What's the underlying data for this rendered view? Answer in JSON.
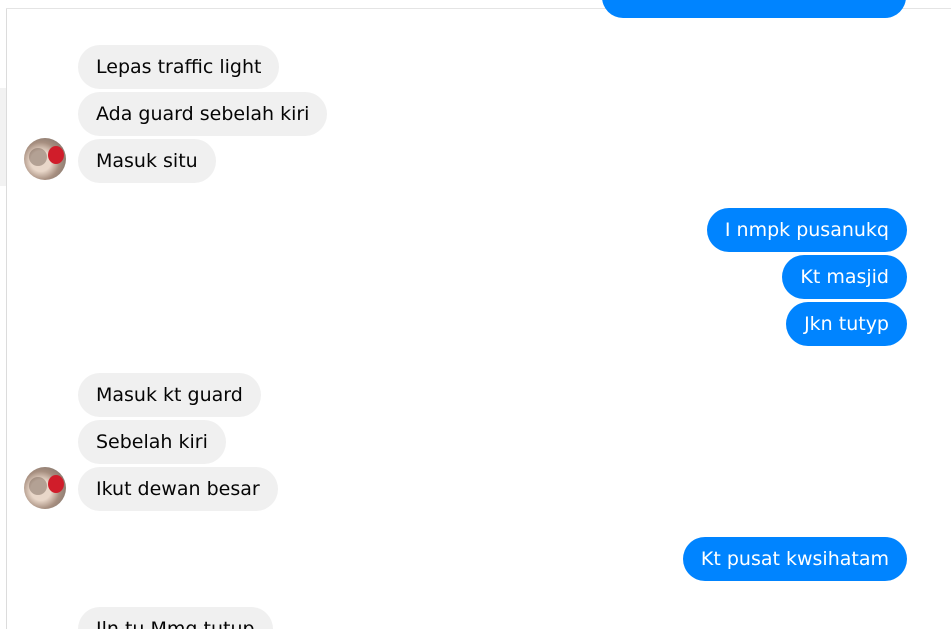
{
  "conversation": {
    "groups": [
      {
        "sender": "them",
        "avatar_icon": "user-avatar-icon",
        "messages": [
          "Lepas traffic light",
          "Ada guard sebelah kiri",
          "Masuk situ"
        ]
      },
      {
        "sender": "me",
        "messages": [
          "I nmpk pusanukq",
          "Kt masjid",
          "Jkn tutyp"
        ]
      },
      {
        "sender": "them",
        "avatar_icon": "user-avatar-icon",
        "messages": [
          "Masuk kt guard",
          "Sebelah kiri",
          "Ikut dewan besar"
        ]
      },
      {
        "sender": "me",
        "messages": [
          "Kt pusat kwsihatam"
        ]
      },
      {
        "sender": "them",
        "messages": [
          "Jln tu Mmg tutup"
        ]
      }
    ]
  },
  "colors": {
    "outgoing_bubble": "#0084ff",
    "incoming_bubble": "#f0f0f0"
  }
}
